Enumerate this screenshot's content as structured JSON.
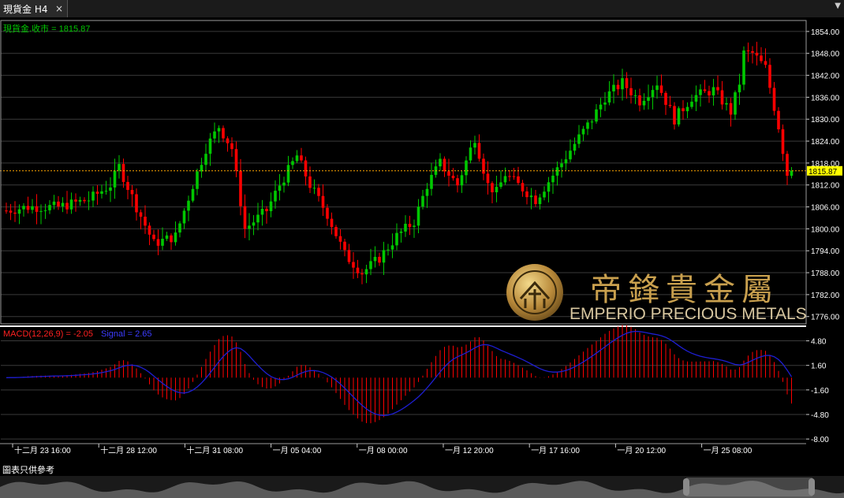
{
  "tab": {
    "title": "現貨金 H4",
    "close_icon": "close-icon"
  },
  "menu_icon": "chevron-down-icon",
  "price_panel": {
    "label": "現貨金.收市 = 1815.87"
  },
  "macd_panel": {
    "macd_label": "MACD(12,26,9) = -2.05",
    "signal_label": "Signal = 2.65"
  },
  "disclaimer": "圖表只供參考",
  "watermark": {
    "cn": "帝鋒貴金屬",
    "en": "EMPERIO PRECIOUS METALS"
  },
  "colors": {
    "up": "#00c800",
    "down": "#ff0000",
    "signal": "#1e1ed2",
    "price_line": "#ffa500",
    "price_tag": "#ffff00",
    "grid": "#3a3a3a",
    "text": "#ffffff"
  },
  "chart_data": [
    {
      "type": "candlestick",
      "series_name": "現貨金",
      "timeframe": "H4",
      "close": 1815.87,
      "y_ticks": [
        1854.0,
        1848.0,
        1842.0,
        1836.0,
        1830.0,
        1824.0,
        1818.0,
        1812.0,
        1806.0,
        1800.0,
        1794.0,
        1788.0,
        1782.0,
        1776.0
      ],
      "ylim": [
        1774.0,
        1857.0
      ],
      "x_tick_labels": [
        "十二月 23 16:00",
        "十二月 28 12:00",
        "十二月 31 08:00",
        "一月 05 04:00",
        "一月 08 00:00",
        "一月 12 20:00",
        "一月 17 16:00",
        "一月 20 12:00",
        "一月 25 08:00"
      ],
      "anchors": [
        [
          0,
          1805
        ],
        [
          5,
          1806
        ],
        [
          12,
          1806
        ],
        [
          19,
          1808
        ],
        [
          24,
          1812
        ],
        [
          26,
          1817
        ],
        [
          30,
          1806
        ],
        [
          34,
          1796
        ],
        [
          39,
          1798
        ],
        [
          43,
          1812
        ],
        [
          46,
          1822
        ],
        [
          49,
          1828
        ],
        [
          52,
          1822
        ],
        [
          55,
          1800
        ],
        [
          60,
          1805
        ],
        [
          63,
          1812
        ],
        [
          67,
          1820
        ],
        [
          70,
          1812
        ],
        [
          74,
          1804
        ],
        [
          78,
          1793
        ],
        [
          82,
          1788
        ],
        [
          86,
          1792
        ],
        [
          90,
          1798
        ],
        [
          94,
          1802
        ],
        [
          97,
          1812
        ],
        [
          100,
          1818
        ],
        [
          104,
          1812
        ],
        [
          108,
          1825
        ],
        [
          111,
          1812
        ],
        [
          113,
          1810
        ],
        [
          115,
          1815
        ],
        [
          118,
          1812
        ],
        [
          122,
          1808
        ],
        [
          128,
          1818
        ],
        [
          132,
          1825
        ],
        [
          135,
          1830
        ],
        [
          138,
          1836
        ],
        [
          142,
          1840
        ],
        [
          146,
          1835
        ],
        [
          150,
          1840
        ],
        [
          154,
          1830
        ],
        [
          158,
          1836
        ],
        [
          163,
          1838
        ],
        [
          167,
          1832
        ],
        [
          169,
          1840
        ],
        [
          170,
          1848
        ],
        [
          172,
          1848
        ],
        [
          175,
          1844
        ],
        [
          178,
          1828
        ],
        [
          180,
          1815
        ],
        [
          181,
          1815.87
        ]
      ]
    },
    {
      "type": "bar+line",
      "name": "MACD(12,26,9)",
      "macd": -2.05,
      "signal": 2.65,
      "y_ticks": [
        4.8,
        1.6,
        -1.6,
        -4.8,
        -8.0
      ],
      "ylim": [
        -8.5,
        6.5
      ]
    }
  ]
}
